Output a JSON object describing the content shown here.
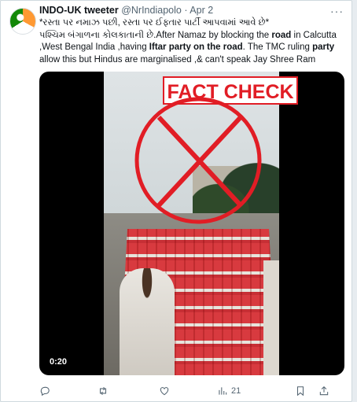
{
  "tweet": {
    "author": "INDO-UK tweeter",
    "handle": "@NrIndiapolo",
    "separator": "·",
    "date": "Apr 2",
    "more_icon": "more-horizontal-icon",
    "lines": [
      "*રસ્તા પર નમાઝ પછી, રસ્તા પર ઈફ્તાર પાર્ટી આપવામાં આવે છે*",
      "પશ્ચિમ બંગાળના કોલકાતાની છે.After  Namaz by blocking the road in Calcutta",
      ",West Bengal India ,having Iftar party on the road. The TMC ruling party",
      "allow this but Hindus are marginalised ,& can't speak Jay Shree Ram"
    ],
    "line2_parts": [
      "પશ્ચિમ બંગાળના કોલકાતાની છે.After  Namaz by blocking the ",
      "road",
      " in Calcutta"
    ],
    "line3_parts": [
      ",West Bengal India ,having ",
      "Iftar party on the road",
      ". The TMC ruling ",
      "party"
    ],
    "line4_parts": [
      "allow this but Hindus are marginalised ,& can't speak Jay Shree Ram"
    ]
  },
  "video": {
    "overlay_label": "FACT CHECK",
    "duration": "0:20",
    "accent_color": "#e11d25"
  },
  "actions": {
    "reply_icon": "reply-icon",
    "retweet_icon": "retweet-icon",
    "like_icon": "heart-icon",
    "views_icon": "views-bar-chart-icon",
    "views_count": "21",
    "bookmark_icon": "bookmark-icon",
    "share_icon": "share-icon"
  }
}
